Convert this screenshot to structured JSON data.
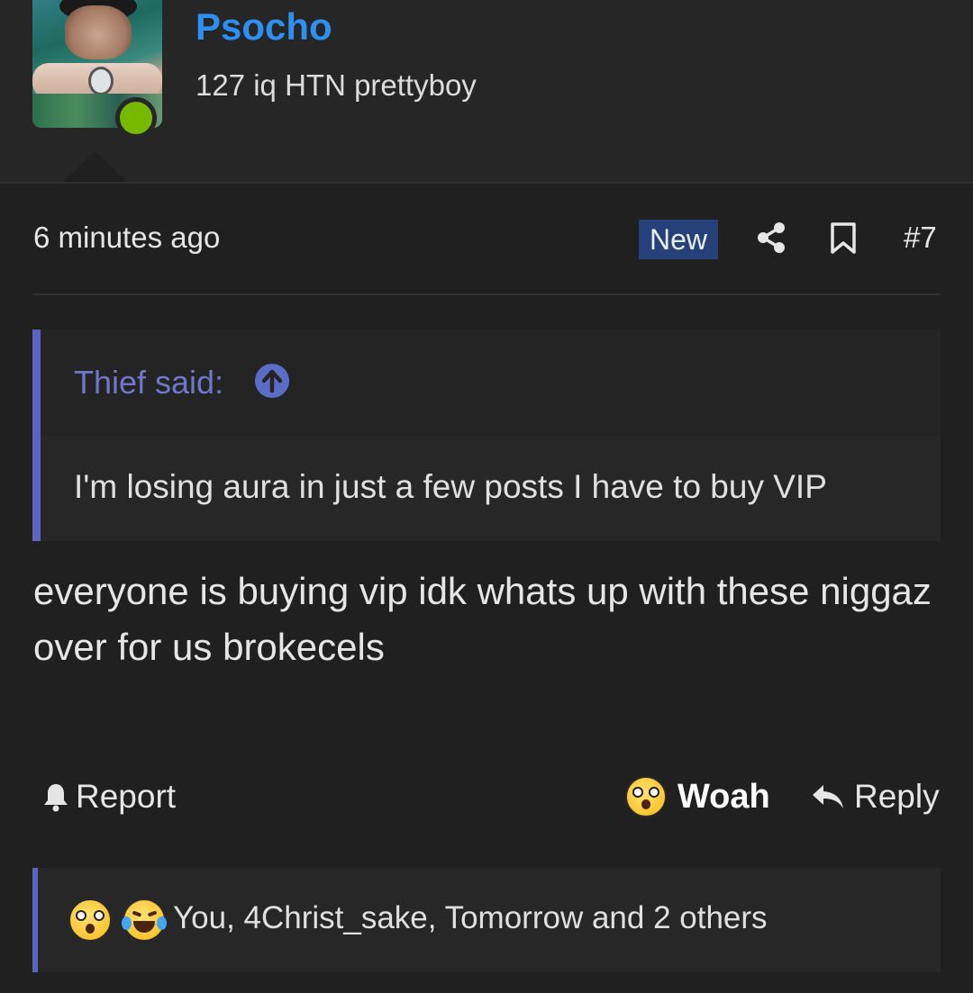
{
  "user": {
    "name": "Psocho",
    "title": "127 iq HTN prettyboy",
    "status_color": "#76b900",
    "name_color": "#2d8ff0"
  },
  "post": {
    "time": "6 minutes ago",
    "badge": "New",
    "number": "#7",
    "share_icon": "share-icon",
    "bookmark_icon": "bookmark-icon"
  },
  "quote": {
    "author": "Thief said:",
    "text": "I'm losing aura in just a few posts I have to buy VIP",
    "accent_color": "#5b64c0"
  },
  "message": {
    "lines": [
      "everyone is buying vip idk whats up with these niggaz",
      "over for us brokecels"
    ]
  },
  "actions": {
    "report": "Report",
    "woah": "Woah",
    "reply": "Reply"
  },
  "reactions": {
    "summary": "You, 4Christ_sake, Tomorrow and 2 others",
    "icons": [
      "woah-emoji-icon",
      "laughing-crying-emoji-icon"
    ]
  }
}
